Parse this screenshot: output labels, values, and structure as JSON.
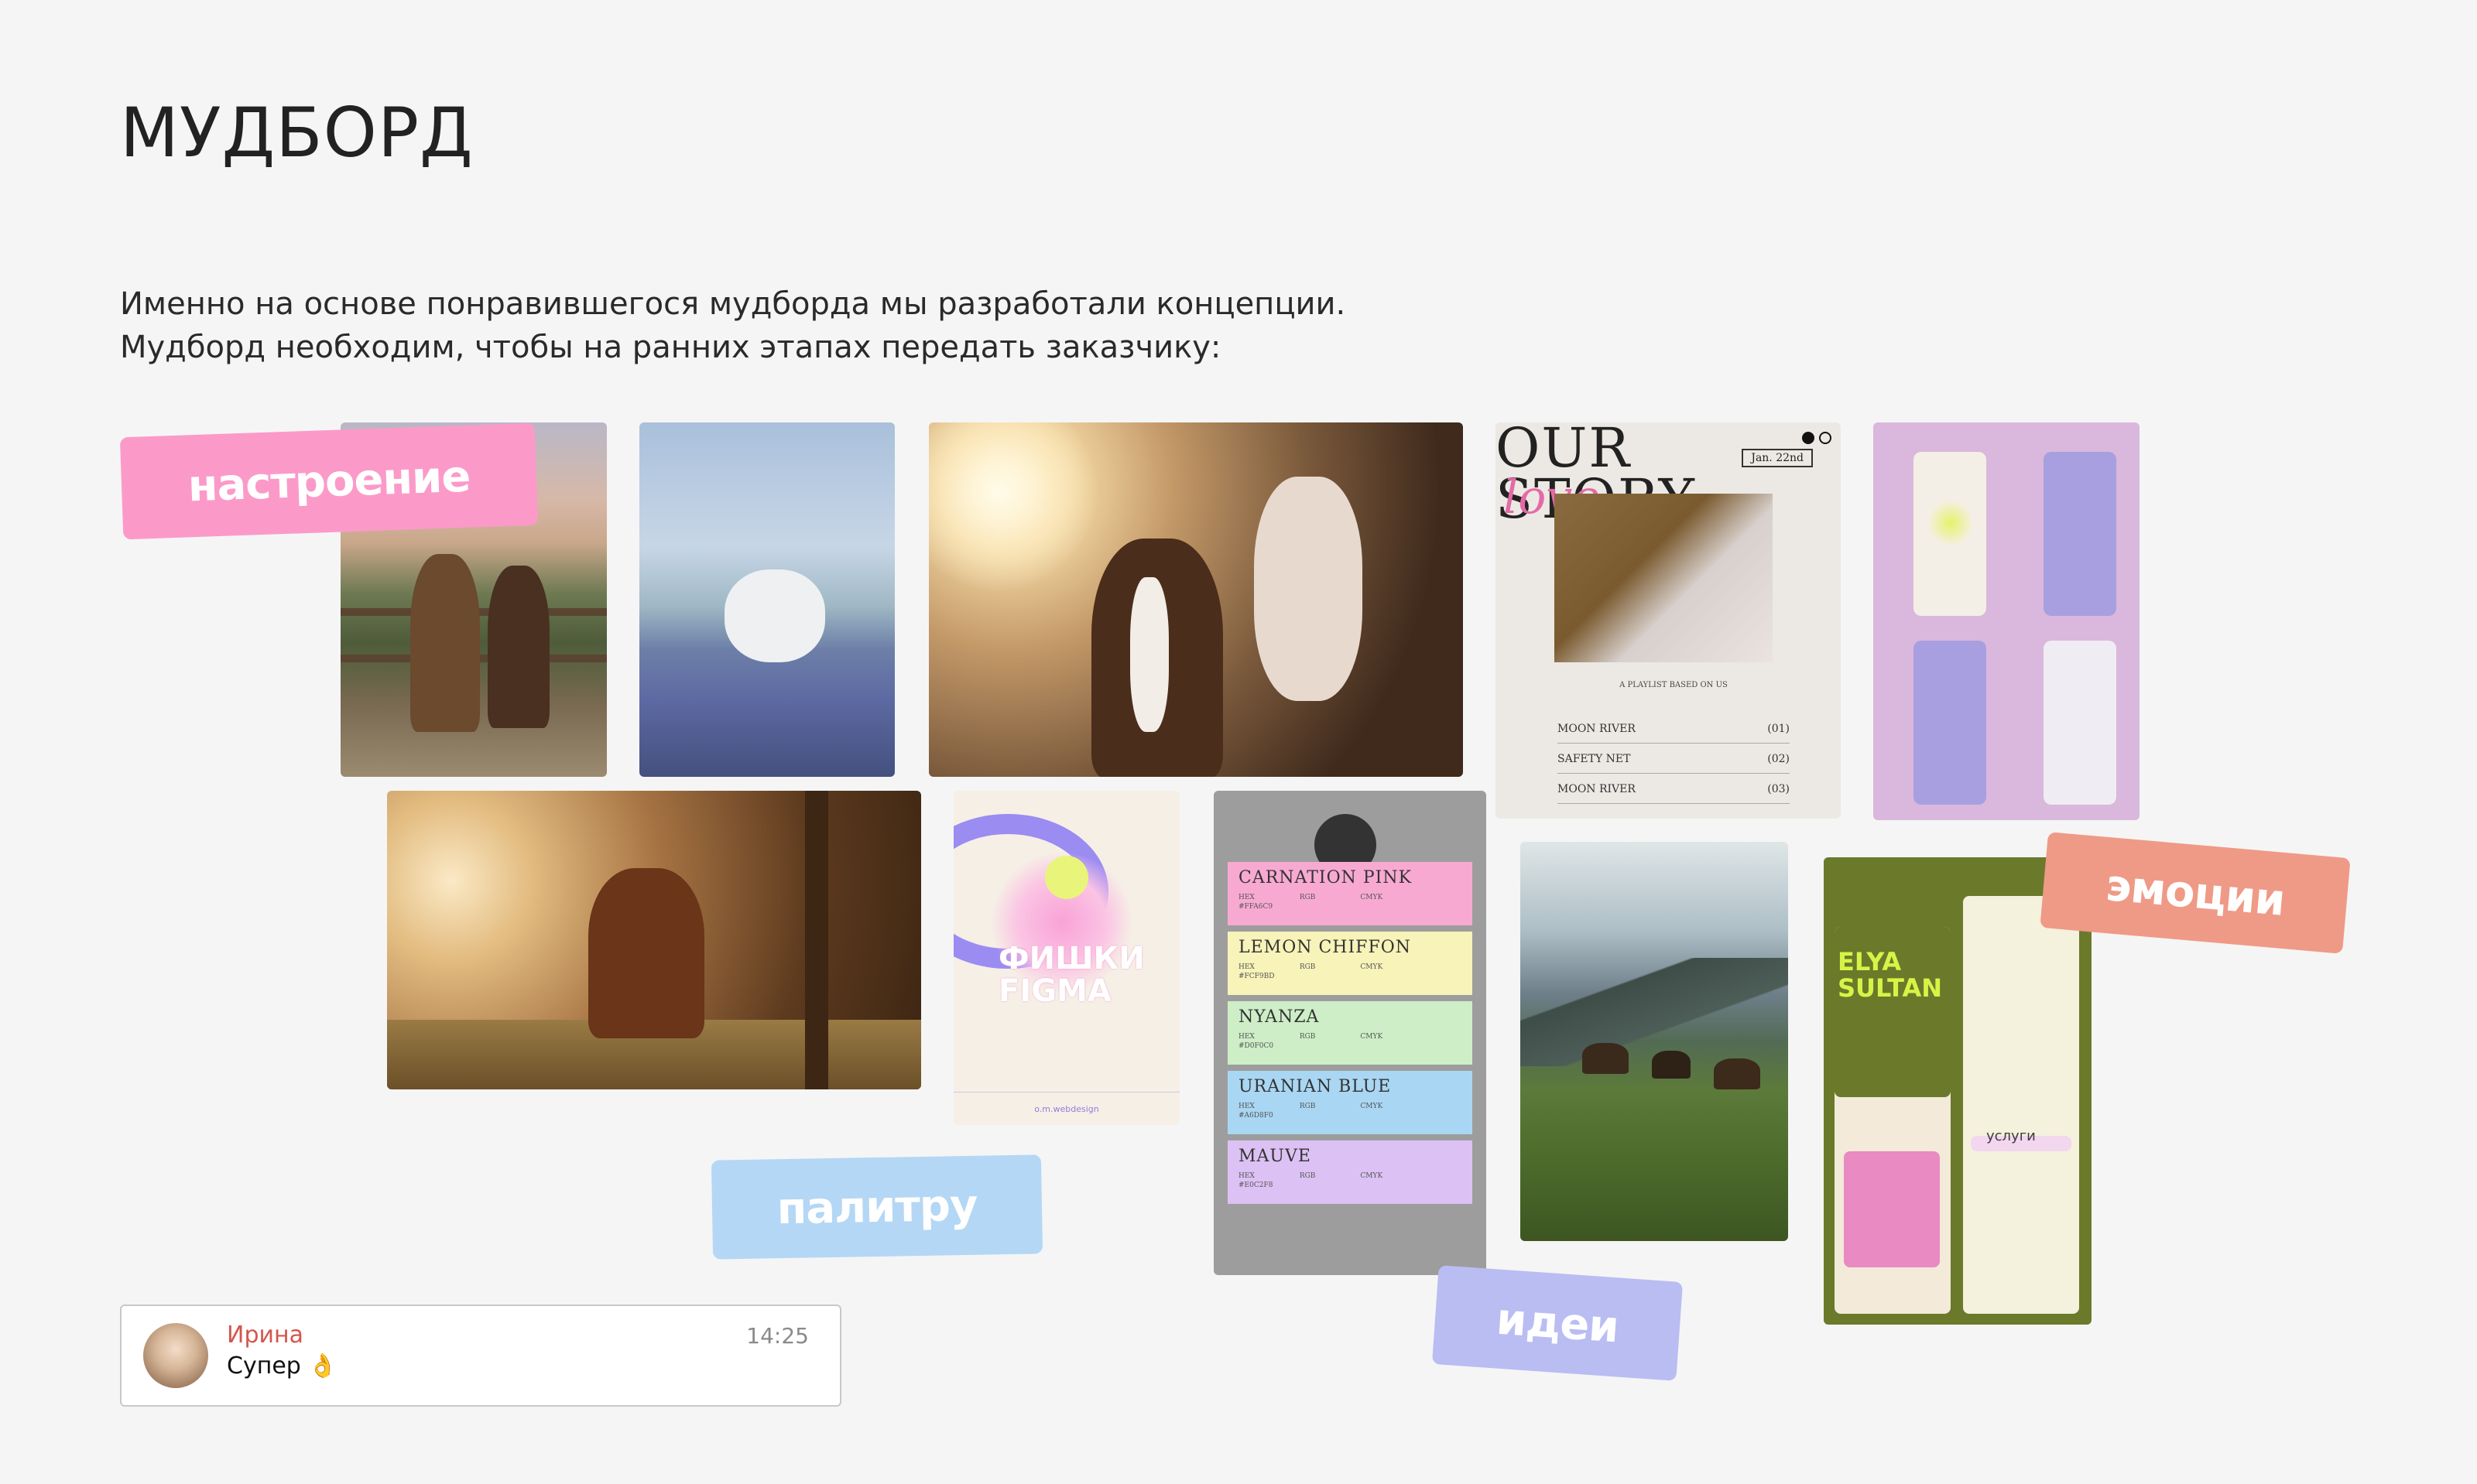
{
  "page": {
    "title": "МУДБОРД",
    "intro_line1": "Именно на основе понравившегося мудборда мы разработали концепции.",
    "intro_line2": "Мудборд необходим, чтобы на ранних этапах передать заказчику:"
  },
  "stickers": {
    "mood": "настроение",
    "emotions": "эмоции",
    "palette": "палитру",
    "ideas": "идеи"
  },
  "story_card": {
    "title_line1": "OUR",
    "title_line2": "STORY",
    "script": "love",
    "date": "Jan. 22nd",
    "playlist_label": "A PLAYLIST BASED ON US",
    "tracks": [
      {
        "name": "MOON RIVER",
        "time": "(01)"
      },
      {
        "name": "SAFETY NET",
        "time": "(02)"
      },
      {
        "name": "MOON RIVER",
        "time": "(03)"
      }
    ]
  },
  "figma_card": {
    "title_line1": "ФИШКИ",
    "title_line2": "FIGMA",
    "footer": "o.m.webdesign"
  },
  "palette_card": {
    "swatches": [
      {
        "name": "CARNATION PINK",
        "hex": "#FFA6C9",
        "color": "#f8a9d2"
      },
      {
        "name": "LEMON CHIFFON",
        "hex": "#FCF9BD",
        "color": "#f7f3b9"
      },
      {
        "name": "NYANZA",
        "hex": "#D0F0C0",
        "color": "#cdeec6"
      },
      {
        "name": "URANIAN BLUE",
        "hex": "#A6D8F0",
        "color": "#a9d6f3"
      },
      {
        "name": "MAUVE",
        "hex": "#E0C2F8",
        "color": "#dcc1f4"
      }
    ],
    "label_hex": "HEX",
    "label_rgb": "RGB",
    "label_cmyk": "CMYK"
  },
  "sultan_card": {
    "title_line1": "ELYA",
    "title_line2": "SULTAN",
    "services": "услуги"
  },
  "chat": {
    "name": "Ирина",
    "message": "Супер 👌",
    "time": "14:25"
  },
  "colors": {
    "background": "#f5f5f5",
    "mood_sticker": "#fb9ac8",
    "emotions_sticker": "#ef9a86",
    "palette_sticker": "#b4d7f5",
    "ideas_sticker": "#b9bdf2",
    "chat_name": "#d4564e"
  }
}
